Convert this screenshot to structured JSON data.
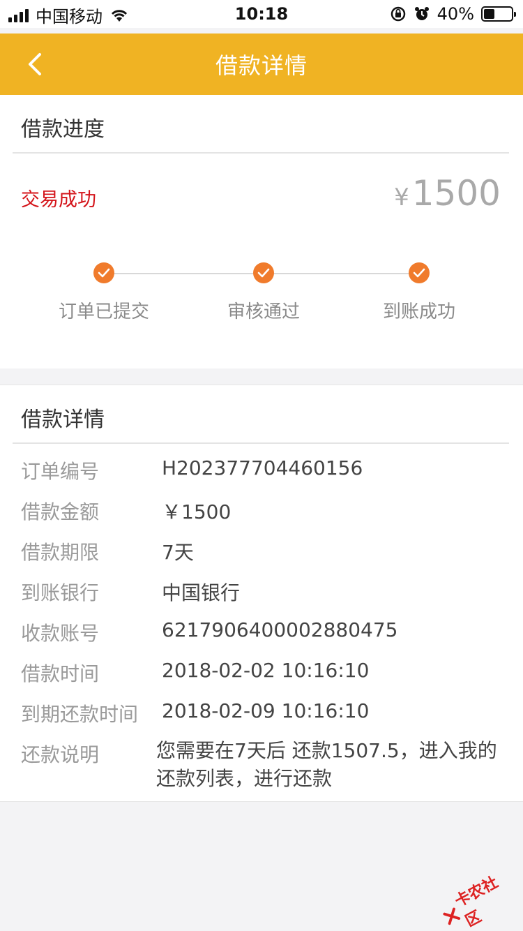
{
  "status_bar": {
    "carrier": "中国移动",
    "time": "10:18",
    "battery_percent": "40%",
    "battery_level": 0.4
  },
  "nav": {
    "title": "借款详情",
    "back_icon": "chevron-left-icon"
  },
  "progress": {
    "header": "借款进度",
    "status": "交易成功",
    "currency": "¥",
    "amount": "1500",
    "steps": [
      {
        "label": "订单已提交",
        "done": true
      },
      {
        "label": "审核通过",
        "done": true
      },
      {
        "label": "到账成功",
        "done": true
      }
    ]
  },
  "details": {
    "header": "借款详情",
    "rows": [
      {
        "label": "订单编号",
        "value": "H202377704460156"
      },
      {
        "label": "借款金额",
        "value": "￥1500"
      },
      {
        "label": "借款期限",
        "value": "7天"
      },
      {
        "label": "到账银行",
        "value": "中国银行"
      },
      {
        "label": "收款账号",
        "value": "6217906400002880475"
      },
      {
        "label": "借款时间",
        "value": "2018-02-02 10:16:10"
      },
      {
        "label": "到期还款时间",
        "value": "2018-02-09 10:16:10"
      },
      {
        "label": "还款说明",
        "value": "您需要在7天后 还款1507.5，进入我的还款列表，进行还款"
      }
    ]
  },
  "watermark": {
    "text": "卡农社区"
  },
  "colors": {
    "nav_bg": "#f0b323",
    "status_red": "#d4141a",
    "step_orange": "#f07b2c"
  }
}
